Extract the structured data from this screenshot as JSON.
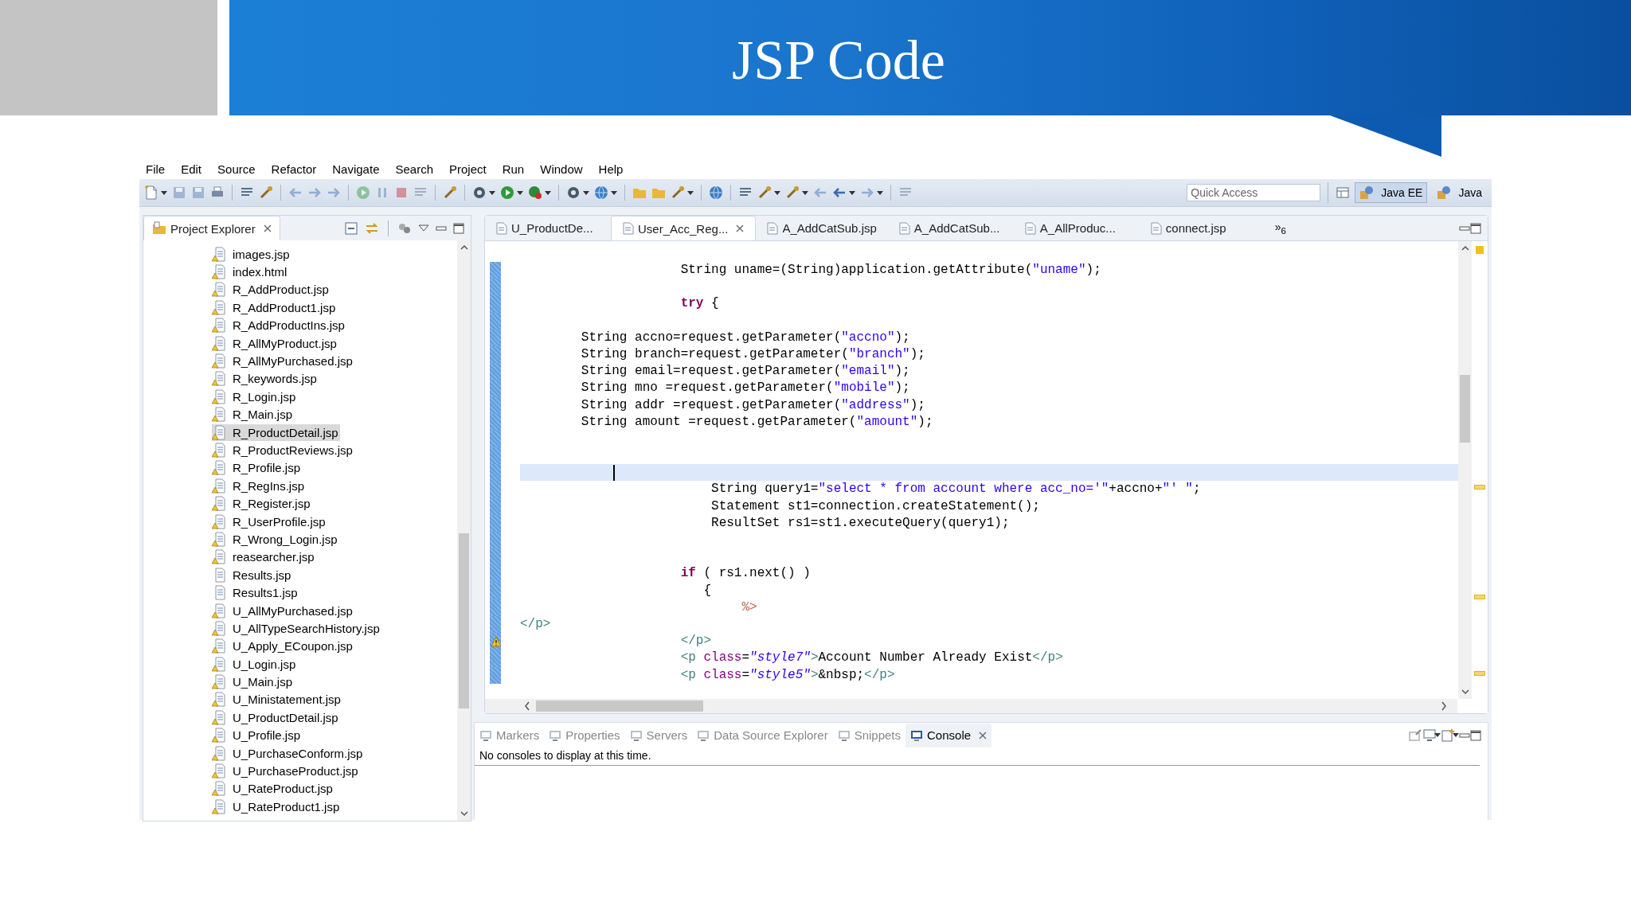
{
  "slide": {
    "title": "JSP Code"
  },
  "menu": [
    "File",
    "Edit",
    "Source",
    "Refactor",
    "Navigate",
    "Search",
    "Project",
    "Run",
    "Window",
    "Help"
  ],
  "quick_access": {
    "placeholder": "Quick Access"
  },
  "perspectives": [
    {
      "label": "Java EE",
      "selected": true
    },
    {
      "label": "Java",
      "selected": false
    }
  ],
  "explorer": {
    "title": "Project Explorer",
    "files": [
      {
        "name": "images.jsp",
        "warning": true,
        "selected": false
      },
      {
        "name": "index.html",
        "warning": true,
        "selected": false
      },
      {
        "name": "R_AddProduct.jsp",
        "warning": true,
        "selected": false
      },
      {
        "name": "R_AddProduct1.jsp",
        "warning": true,
        "selected": false
      },
      {
        "name": "R_AddProductIns.jsp",
        "warning": true,
        "selected": false
      },
      {
        "name": "R_AllMyProduct.jsp",
        "warning": true,
        "selected": false
      },
      {
        "name": "R_AllMyPurchased.jsp",
        "warning": true,
        "selected": false
      },
      {
        "name": "R_keywords.jsp",
        "warning": true,
        "selected": false
      },
      {
        "name": "R_Login.jsp",
        "warning": true,
        "selected": false
      },
      {
        "name": "R_Main.jsp",
        "warning": true,
        "selected": false
      },
      {
        "name": "R_ProductDetail.jsp",
        "warning": true,
        "selected": true
      },
      {
        "name": "R_ProductReviews.jsp",
        "warning": true,
        "selected": false
      },
      {
        "name": "R_Profile.jsp",
        "warning": true,
        "selected": false
      },
      {
        "name": "R_RegIns.jsp",
        "warning": true,
        "selected": false
      },
      {
        "name": "R_Register.jsp",
        "warning": true,
        "selected": false
      },
      {
        "name": "R_UserProfile.jsp",
        "warning": true,
        "selected": false
      },
      {
        "name": "R_Wrong_Login.jsp",
        "warning": true,
        "selected": false
      },
      {
        "name": "reasearcher.jsp",
        "warning": true,
        "selected": false
      },
      {
        "name": "Results.jsp",
        "warning": false,
        "selected": false
      },
      {
        "name": "Results1.jsp",
        "warning": false,
        "selected": false
      },
      {
        "name": "U_AllMyPurchased.jsp",
        "warning": true,
        "selected": false
      },
      {
        "name": "U_AllTypeSearchHistory.jsp",
        "warning": true,
        "selected": false
      },
      {
        "name": "U_Apply_ECoupon.jsp",
        "warning": true,
        "selected": false
      },
      {
        "name": "U_Login.jsp",
        "warning": true,
        "selected": false
      },
      {
        "name": "U_Main.jsp",
        "warning": true,
        "selected": false
      },
      {
        "name": "U_Ministatement.jsp",
        "warning": true,
        "selected": false
      },
      {
        "name": "U_ProductDetail.jsp",
        "warning": true,
        "selected": false
      },
      {
        "name": "U_Profile.jsp",
        "warning": true,
        "selected": false
      },
      {
        "name": "U_PurchaseConform.jsp",
        "warning": true,
        "selected": false
      },
      {
        "name": "U_PurchaseProduct.jsp",
        "warning": true,
        "selected": false
      },
      {
        "name": "U_RateProduct.jsp",
        "warning": true,
        "selected": false
      },
      {
        "name": "U_RateProduct1.jsp",
        "warning": true,
        "selected": false
      }
    ]
  },
  "editor": {
    "tabs": [
      {
        "label": "U_ProductDe...",
        "selected": false
      },
      {
        "label": "User_Acc_Reg...",
        "selected": true
      },
      {
        "label": "A_AddCatSub.jsp",
        "selected": false
      },
      {
        "label": "A_AddCatSub...",
        "selected": false
      },
      {
        "label": "A_AllProduc...",
        "selected": false
      },
      {
        "label": "connect.jsp",
        "selected": false
      }
    ],
    "overflow": "»$_{6}$",
    "lines": [
      {
        "kind": "code",
        "current": false,
        "warning": false,
        "segments": [
          {
            "kind": "plain",
            "text": "                     String uname=(String)application.getAttribute("
          },
          {
            "kind": "string",
            "text": "\"uname\""
          },
          {
            "kind": "plain",
            "text": ");"
          }
        ]
      },
      {
        "kind": "blank",
        "current": false,
        "warning": false
      },
      {
        "kind": "code",
        "current": false,
        "warning": false,
        "segments": [
          {
            "kind": "keyword",
            "text": "                     try"
          },
          {
            "kind": "plain",
            "text": " {"
          }
        ]
      },
      {
        "kind": "blank",
        "current": false,
        "warning": false
      },
      {
        "kind": "code",
        "current": false,
        "warning": false,
        "segments": [
          {
            "kind": "plain",
            "text": "        String accno=request.getParameter("
          },
          {
            "kind": "string",
            "text": "\"accno\""
          },
          {
            "kind": "plain",
            "text": ");"
          }
        ]
      },
      {
        "kind": "code",
        "current": false,
        "warning": false,
        "segments": [
          {
            "kind": "plain",
            "text": "        String branch=request.getParameter("
          },
          {
            "kind": "string",
            "text": "\"branch\""
          },
          {
            "kind": "plain",
            "text": ");"
          }
        ]
      },
      {
        "kind": "code",
        "current": false,
        "warning": false,
        "segments": [
          {
            "kind": "plain",
            "text": "        String email=request.getParameter("
          },
          {
            "kind": "string",
            "text": "\"email\""
          },
          {
            "kind": "plain",
            "text": ");"
          }
        ]
      },
      {
        "kind": "code",
        "current": false,
        "warning": false,
        "segments": [
          {
            "kind": "plain",
            "text": "        String mno =request.getParameter("
          },
          {
            "kind": "string",
            "text": "\"mobile\""
          },
          {
            "kind": "plain",
            "text": ");"
          }
        ]
      },
      {
        "kind": "code",
        "current": false,
        "warning": false,
        "segments": [
          {
            "kind": "plain",
            "text": "        String addr =request.getParameter("
          },
          {
            "kind": "string",
            "text": "\"address\""
          },
          {
            "kind": "plain",
            "text": ");"
          }
        ]
      },
      {
        "kind": "code",
        "current": false,
        "warning": false,
        "segments": [
          {
            "kind": "plain",
            "text": "        String amount =request.getParameter("
          },
          {
            "kind": "string",
            "text": "\"amount\""
          },
          {
            "kind": "plain",
            "text": ");"
          }
        ]
      },
      {
        "kind": "blank",
        "current": false,
        "warning": false
      },
      {
        "kind": "blank",
        "current": false,
        "warning": false
      },
      {
        "kind": "blank",
        "current": true,
        "warning": false
      },
      {
        "kind": "code",
        "current": false,
        "warning": false,
        "segments": [
          {
            "kind": "plain",
            "text": "                         String query1="
          },
          {
            "kind": "string",
            "text": "\"select * from account where acc_no='\""
          },
          {
            "kind": "plain",
            "text": "+accno+"
          },
          {
            "kind": "string",
            "text": "\"' \""
          },
          {
            "kind": "plain",
            "text": ";"
          }
        ]
      },
      {
        "kind": "code",
        "current": false,
        "warning": false,
        "segments": [
          {
            "kind": "plain",
            "text": "                         Statement st1=connection.createStatement();"
          }
        ]
      },
      {
        "kind": "code",
        "current": false,
        "warning": false,
        "segments": [
          {
            "kind": "plain",
            "text": "                         ResultSet rs1=st1.executeQuery(query1);"
          }
        ]
      },
      {
        "kind": "blank",
        "current": false,
        "warning": false
      },
      {
        "kind": "blank",
        "current": false,
        "warning": false
      },
      {
        "kind": "code",
        "current": false,
        "warning": false,
        "segments": [
          {
            "kind": "keyword",
            "text": "                     if"
          },
          {
            "kind": "plain",
            "text": " ( rs1.next() )"
          }
        ]
      },
      {
        "kind": "code",
        "current": false,
        "warning": false,
        "segments": [
          {
            "kind": "plain",
            "text": "                        {"
          }
        ]
      },
      {
        "kind": "code",
        "current": false,
        "warning": false,
        "segments": [
          {
            "kind": "jsp",
            "text": "                             %>"
          }
        ]
      },
      {
        "kind": "code",
        "current": false,
        "warning": false,
        "segments": [
          {
            "kind": "tag",
            "text": "</p>"
          }
        ]
      },
      {
        "kind": "code",
        "current": false,
        "warning": true,
        "segments": [
          {
            "kind": "tag",
            "text": "                     </p>"
          }
        ]
      },
      {
        "kind": "code",
        "current": false,
        "warning": false,
        "segments": [
          {
            "kind": "tag",
            "text": "                     <p "
          },
          {
            "kind": "attr",
            "text": "class"
          },
          {
            "kind": "plain",
            "text": "="
          },
          {
            "kind": "value",
            "text": "\"style7\""
          },
          {
            "kind": "tag",
            "text": ">"
          },
          {
            "kind": "plain",
            "text": "Account Number Already Exist"
          },
          {
            "kind": "tag",
            "text": "</p>"
          }
        ]
      },
      {
        "kind": "code",
        "current": false,
        "warning": false,
        "segments": [
          {
            "kind": "tag",
            "text": "                     <p "
          },
          {
            "kind": "attr",
            "text": "class"
          },
          {
            "kind": "plain",
            "text": "="
          },
          {
            "kind": "value",
            "text": "\"style5\""
          },
          {
            "kind": "tag",
            "text": ">"
          },
          {
            "kind": "plain",
            "text": "&nbsp;"
          },
          {
            "kind": "tag",
            "text": "</p>"
          }
        ]
      }
    ]
  },
  "bottom_panel": {
    "tabs": [
      {
        "label": "Markers",
        "selected": false
      },
      {
        "label": "Properties",
        "selected": false
      },
      {
        "label": "Servers",
        "selected": false
      },
      {
        "label": "Data Source Explorer",
        "selected": false
      },
      {
        "label": "Snippets",
        "selected": false
      },
      {
        "label": "Console",
        "selected": true
      }
    ],
    "message": "No consoles to display at this time."
  }
}
